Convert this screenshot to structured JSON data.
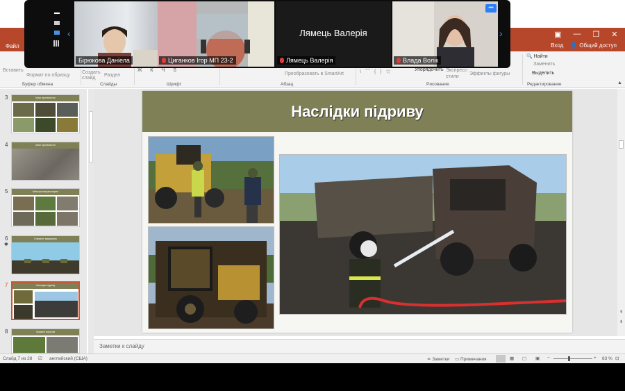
{
  "zoom": {
    "participants": [
      {
        "name": "Бірюкова Даніела",
        "muted": false
      },
      {
        "name": "Циганков Ігор МП 23-2",
        "muted": true
      },
      {
        "name": "Лямець Валерія",
        "muted": true,
        "center_label": "Лямець Валерія"
      },
      {
        "name": "Влада Волік",
        "muted": true
      }
    ],
    "more_label": "•••"
  },
  "app": {
    "tabs": {
      "file": "Файл"
    },
    "signin": "Вход",
    "share": "Общий доступ",
    "search": "Найти",
    "replace": "Заменить",
    "select": "Выделить",
    "edit_group": "Редактирование"
  },
  "ribbon": {
    "paste": "Вставить",
    "format_painter": "Формат по образцу",
    "new_slide": "Создать слайд",
    "section": "Раздел",
    "convert_smartart": "Преобразовать в SmartArt",
    "arrange": "Упорядочить",
    "quick_styles": "Экспресс-стили",
    "shape_effects": "Эффекты фигуры",
    "groups": {
      "clipboard": "Буфер обмена",
      "slides": "Слайды",
      "font": "Шрифт",
      "paragraph": "Абзац",
      "drawing": "Рисование",
      "editing": "Редактирование"
    }
  },
  "thumbnails": [
    {
      "num": "3",
      "title": "Міни протипіхотні"
    },
    {
      "num": "4",
      "title": "Міни протипіхотні"
    },
    {
      "num": "5",
      "title": "Міни протитранспортні"
    },
    {
      "num": "6",
      "title": "Елемент замикання"
    },
    {
      "num": "7",
      "title": "Наслідки підриву"
    },
    {
      "num": "8",
      "title": "Уражені ворогом"
    }
  ],
  "slide": {
    "title": "Наслідки підриву"
  },
  "notes": {
    "placeholder": "Заметки к слайду"
  },
  "status": {
    "slide": "Слайд 7 из 28",
    "language": "английский (США)",
    "notes_btn": "Заметки",
    "comments_btn": "Примечания",
    "zoom": "83 %"
  },
  "colors": {
    "accent": "#b7472a",
    "banner": "#7f8055",
    "zoom_bg": "#0d0d0d"
  }
}
